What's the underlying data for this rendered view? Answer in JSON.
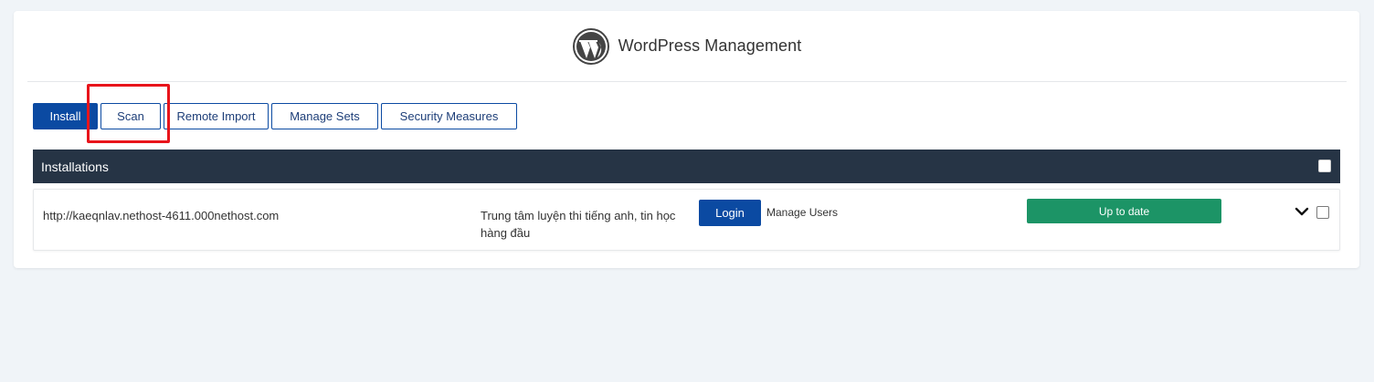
{
  "header": {
    "title": "WordPress Management",
    "logo_icon": "wordpress-logo-icon"
  },
  "tabs": [
    {
      "label": "Install",
      "active": true
    },
    {
      "label": "Scan",
      "active": false
    },
    {
      "label": "Remote Import",
      "active": false
    },
    {
      "label": "Manage Sets",
      "active": false
    },
    {
      "label": "Security Measures",
      "active": false
    }
  ],
  "installations": {
    "title": "Installations",
    "rows": [
      {
        "url": "http://kaeqnlav.nethost-4611.000nethost.com",
        "description": "Trung tâm luyện thi tiếng anh, tin học hàng đầu",
        "login_label": "Login",
        "manage_users_label": "Manage Users",
        "status": "Up to date"
      }
    ]
  },
  "colors": {
    "primary": "#0b4aa2",
    "header_bar": "#263445",
    "status_ok": "#1c9466",
    "highlight": "#e8141b"
  }
}
